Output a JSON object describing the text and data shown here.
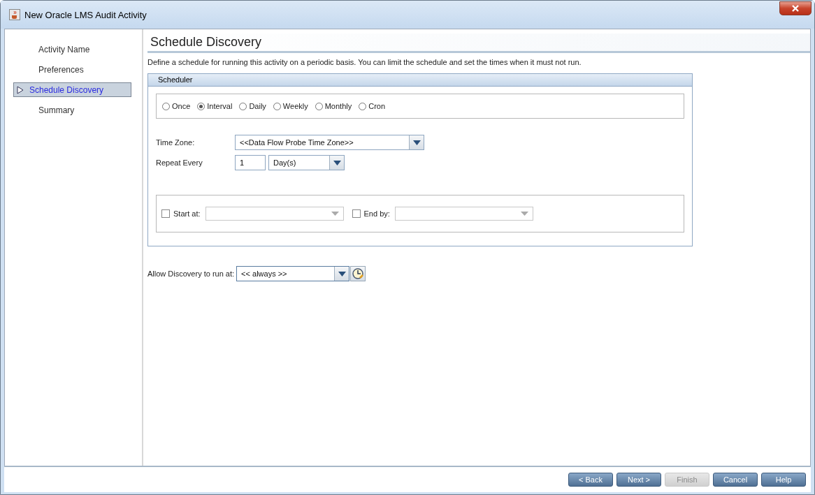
{
  "window": {
    "title": "New Oracle LMS Audit Activity"
  },
  "sidebar": {
    "items": [
      {
        "label": "Activity Name",
        "selected": false
      },
      {
        "label": "Preferences",
        "selected": false
      },
      {
        "label": "Schedule Discovery",
        "selected": true
      },
      {
        "label": "Summary",
        "selected": false
      }
    ]
  },
  "page": {
    "title": "Schedule Discovery",
    "description": "Define a schedule for running this activity on a periodic basis. You can limit the schedule and set the times when it must not run."
  },
  "scheduler": {
    "title": "Scheduler",
    "modes": [
      {
        "label": "Once",
        "selected": false
      },
      {
        "label": "Interval",
        "selected": true
      },
      {
        "label": "Daily",
        "selected": false
      },
      {
        "label": "Weekly",
        "selected": false
      },
      {
        "label": "Monthly",
        "selected": false
      },
      {
        "label": "Cron",
        "selected": false
      }
    ],
    "time_zone": {
      "label": "Time Zone:",
      "value": "<<Data Flow Probe Time Zone>>"
    },
    "repeat_every": {
      "label": "Repeat Every",
      "value": "1",
      "unit": "Day(s)"
    },
    "limits": [
      {
        "label": "Start at:",
        "checked": false
      },
      {
        "label": "End by:",
        "checked": false
      }
    ]
  },
  "allow_run": {
    "label": "Allow Discovery to run at:",
    "value": "<< always >>"
  },
  "buttons": [
    {
      "label": "< Back",
      "disabled": false
    },
    {
      "label": "Next >",
      "disabled": false
    },
    {
      "label": "Finish",
      "disabled": true
    },
    {
      "label": "Cancel",
      "disabled": false
    },
    {
      "label": "Help",
      "disabled": false
    }
  ]
}
